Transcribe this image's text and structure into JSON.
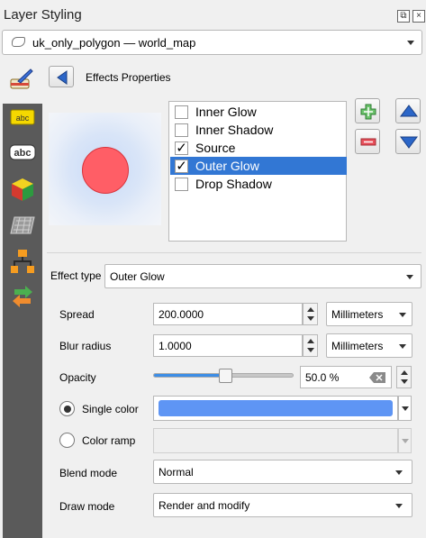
{
  "window": {
    "title": "Layer Styling"
  },
  "layer_selector": {
    "value": "uk_only_polygon — world_map"
  },
  "effects": {
    "header": "Effects Properties",
    "list": [
      {
        "label": "Inner Glow",
        "checked": false,
        "selected": false
      },
      {
        "label": "Inner Shadow",
        "checked": false,
        "selected": false
      },
      {
        "label": "Source",
        "checked": true,
        "selected": false
      },
      {
        "label": "Outer Glow",
        "checked": true,
        "selected": true
      },
      {
        "label": "Drop Shadow",
        "checked": false,
        "selected": false
      }
    ],
    "check_mark": "✓"
  },
  "effect_type": {
    "label": "Effect type",
    "value": "Outer Glow"
  },
  "spread": {
    "label": "Spread",
    "value": "200.0000",
    "unit": "Millimeters"
  },
  "blur_radius": {
    "label": "Blur radius",
    "value": "1.0000",
    "unit": "Millimeters"
  },
  "opacity": {
    "label": "Opacity",
    "value": "50.0 %",
    "level": 0.5
  },
  "single_color": {
    "label": "Single color",
    "selected": true,
    "color": "#5e95f4"
  },
  "color_ramp": {
    "label": "Color ramp",
    "selected": false
  },
  "blend_mode": {
    "label": "Blend mode",
    "value": "Normal"
  },
  "draw_mode": {
    "label": "Draw mode",
    "value": "Render and modify"
  },
  "colors": {
    "accent": "#3277d4",
    "preview_fill": "#ff5e66",
    "sidebar": "#5a5a5a"
  },
  "icons": {
    "sidebar": [
      "paint-brush-icon",
      "label-abc-icon",
      "label-abc-outline-icon",
      "3d-cube-icon",
      "3d-map-icon",
      "diagram-icon",
      "history-arrow-icon"
    ],
    "buttons": [
      "add-effect-icon",
      "remove-effect-icon",
      "move-up-icon",
      "move-down-icon",
      "back-arrow-icon"
    ]
  }
}
